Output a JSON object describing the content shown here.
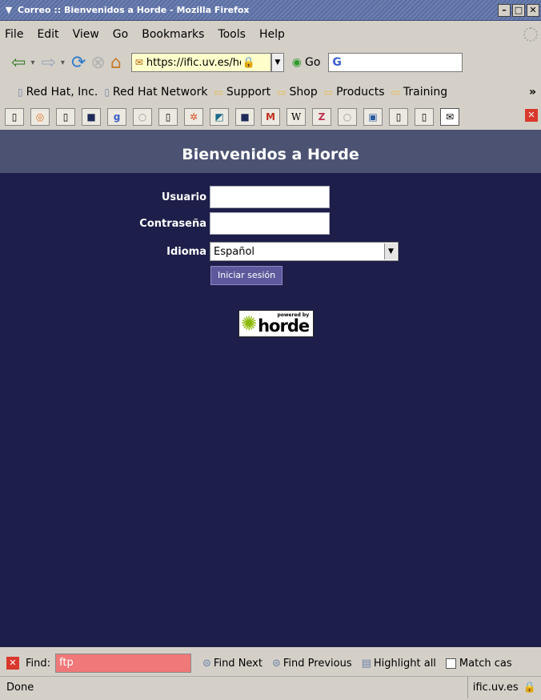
{
  "window": {
    "title": "Correo :: Bienvenidos a Horde - Mozilla Firefox"
  },
  "menu": {
    "items": [
      "File",
      "Edit",
      "View",
      "Go",
      "Bookmarks",
      "Tools",
      "Help"
    ]
  },
  "toolbar": {
    "url": "https://ific.uv.es/hor",
    "go_label": "Go"
  },
  "bookmarks": {
    "items": [
      {
        "label": "Red Hat, Inc.",
        "icon": "page-icon"
      },
      {
        "label": "Red Hat Network",
        "icon": "page-icon"
      },
      {
        "label": "Support",
        "icon": "folder-icon"
      },
      {
        "label": "Shop",
        "icon": "folder-icon"
      },
      {
        "label": "Products",
        "icon": "folder-icon"
      },
      {
        "label": "Training",
        "icon": "folder-icon"
      }
    ],
    "more": "»"
  },
  "page": {
    "heading": "Bienvenidos a Horde",
    "form": {
      "user_label": "Usuario",
      "password_label": "Contraseña",
      "language_label": "Idioma",
      "language_value": "Español",
      "submit_label": "Iniciar sesión"
    },
    "logo": {
      "powered_by": "powered by",
      "name": "horde"
    },
    "colors": {
      "background": "#1e1e4a",
      "banner": "#4c5272",
      "button": "#5c5a9c"
    }
  },
  "find": {
    "label": "Find:",
    "value": "ftp",
    "next": "Find Next",
    "previous": "Find Previous",
    "highlight": "Highlight all",
    "match_case": "Match cas"
  },
  "status": {
    "text": "Done",
    "domain": "ific.uv.es"
  }
}
